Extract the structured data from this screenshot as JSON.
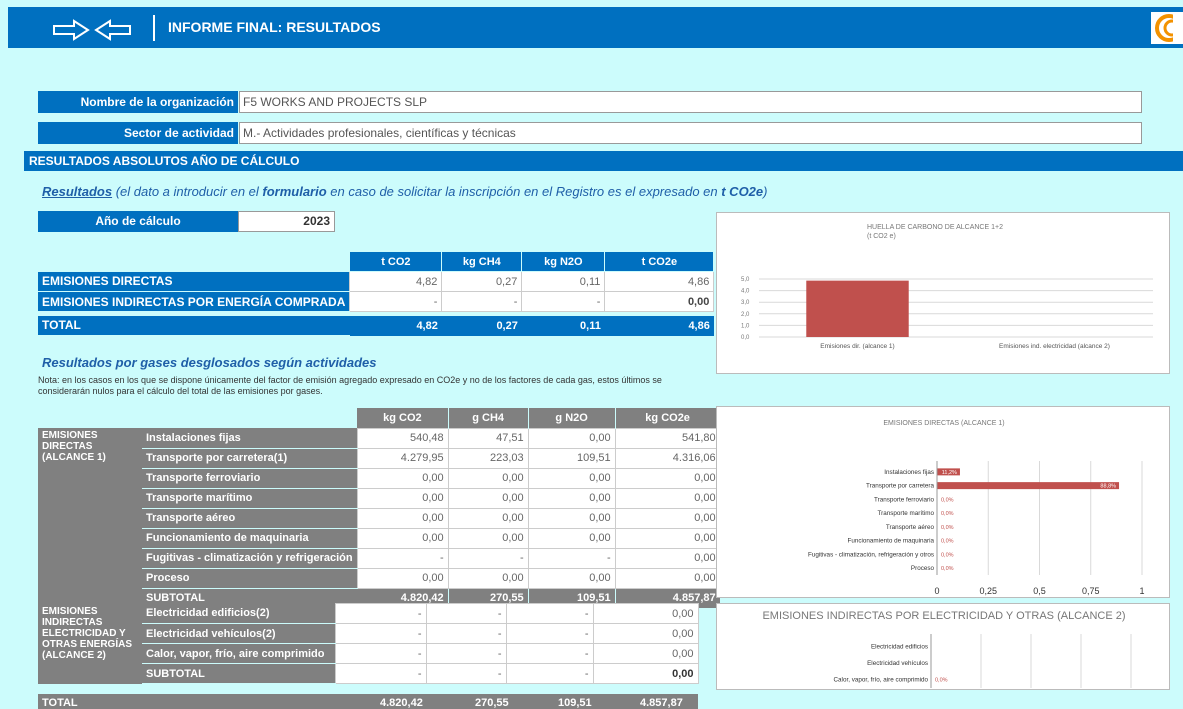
{
  "header": {
    "title": "INFORME FINAL: RESULTADOS"
  },
  "org": {
    "name_label": "Nombre de la organización",
    "name_value": "F5 WORKS AND PROJECTS SLP",
    "sector_label": "Sector de actividad",
    "sector_value": "M.- Actividades profesionales, científicas y técnicas"
  },
  "section_title": "RESULTADOS ABSOLUTOS AÑO DE CÁLCULO",
  "results_intro": {
    "word": "Resultados",
    "p1": " (el dato a introducir en el ",
    "bold": "formulario",
    "p2": " en caso de solicitar la inscripción en el Registro es el expresado en ",
    "unit": "t CO2e",
    "p3": ")"
  },
  "year": {
    "label": "Año  de cálculo",
    "value": "2023"
  },
  "summary_table": {
    "headers": [
      "t CO2",
      "kg CH4",
      "kg N2O",
      "t CO2e"
    ],
    "rows": [
      {
        "label": "EMISIONES DIRECTAS",
        "values": [
          "4,82",
          "0,27",
          "0,11",
          "4,86"
        ]
      },
      {
        "label": "EMISIONES INDIRECTAS POR ENERGÍA COMPRADA",
        "values": [
          "-",
          "-",
          "-",
          "0,00"
        ]
      }
    ],
    "total": {
      "label": "TOTAL",
      "values": [
        "4,82",
        "0,27",
        "0,11",
        "4,86"
      ]
    }
  },
  "gases": {
    "title": "Resultados por gases desglosados según actividades",
    "note": "Nota: en los casos en los que se dispone únicamente del factor de emisión agregado expresado en CO2e y no de los factores de cada gas, estos últimos se considerarán nulos para el cálculo del total de las emisiones por gases.",
    "headers": [
      "kg CO2",
      "g CH4",
      "g N2O",
      "kg CO2e"
    ],
    "group1": "EMISIONES DIRECTAS (ALCANCE 1)",
    "rows1": [
      {
        "label": "Instalaciones fijas",
        "values": [
          "540,48",
          "47,51",
          "0,00",
          "541,80"
        ]
      },
      {
        "label": "Transporte por carretera(1)",
        "values": [
          "4.279,95",
          "223,03",
          "109,51",
          "4.316,06"
        ]
      },
      {
        "label": "Transporte ferroviario",
        "values": [
          "0,00",
          "0,00",
          "0,00",
          "0,00"
        ]
      },
      {
        "label": "Transporte marítimo",
        "values": [
          "0,00",
          "0,00",
          "0,00",
          "0,00"
        ]
      },
      {
        "label": "Transporte aéreo",
        "values": [
          "0,00",
          "0,00",
          "0,00",
          "0,00"
        ]
      },
      {
        "label": "Funcionamiento de maquinaria",
        "values": [
          "0,00",
          "0,00",
          "0,00",
          "0,00"
        ]
      },
      {
        "label": "Fugitivas - climatización y refrigeración",
        "values": [
          "-",
          "-",
          "-",
          "0,00"
        ]
      },
      {
        "label": "Proceso",
        "values": [
          "0,00",
          "0,00",
          "0,00",
          "0,00"
        ]
      }
    ],
    "subtotal1": {
      "label": "SUBTOTAL",
      "values": [
        "4.820,42",
        "270,55",
        "109,51",
        "4.857,87"
      ]
    },
    "group2": "EMISIONES INDIRECTAS ELECTRICIDAD Y OTRAS ENERGÍAS (ALCANCE 2)",
    "rows2": [
      {
        "label": "Electricidad edificios(2)",
        "values": [
          "-",
          "-",
          "-",
          "0,00"
        ]
      },
      {
        "label": "Electricidad vehículos(2)",
        "values": [
          "-",
          "-",
          "-",
          "0,00"
        ]
      },
      {
        "label": "Calor, vapor, frío, aire comprimido",
        "values": [
          "-",
          "-",
          "-",
          "0,00"
        ]
      }
    ],
    "subtotal2": {
      "label": "SUBTOTAL",
      "values": [
        "-",
        "-",
        "-",
        "0,00"
      ]
    },
    "total": {
      "label": "TOTAL",
      "values": [
        "4.820,42",
        "270,55",
        "109,51",
        "4.857,87"
      ]
    }
  },
  "colors": {
    "blue": "#0070c0",
    "bg": "#ccfcfc",
    "gray": "#808080",
    "bar": "#c0504d"
  },
  "chart_data": [
    {
      "type": "bar",
      "title": "HUELLA DE CARBONO DE ALCANCE 1+2",
      "subtitle": "(t CO2 e)",
      "categories": [
        "Emisiones dir. (alcance 1)",
        "Emisiones ind. electricidad (alcance 2)"
      ],
      "values": [
        4.86,
        0
      ],
      "ylim": [
        0,
        5
      ],
      "yticks": [
        "0,0",
        "1,0",
        "2,0",
        "3,0",
        "4,0",
        "5,0"
      ],
      "grid": true
    },
    {
      "type": "bar",
      "orientation": "horizontal",
      "title": "EMISIONES DIRECTAS (ALCANCE 1)",
      "categories": [
        "Instalaciones fijas",
        "Transporte por carretera",
        "Transporte ferroviario",
        "Transporte marítimo",
        "Transporte aéreo",
        "Funcionamiento de maquinaria",
        "Fugitivas - climatización, refrigeración y otros",
        "Proceso"
      ],
      "values": [
        0.112,
        0.888,
        0,
        0,
        0,
        0,
        0,
        0
      ],
      "labels": [
        "11,2%",
        "88,8%",
        "0,0%",
        "0,0%",
        "0,0%",
        "0,0%",
        "0,0%",
        "0,0%"
      ],
      "xlim": [
        0,
        1
      ],
      "xticks": [
        "0",
        "0,25",
        "0,5",
        "0,75",
        "1"
      ]
    },
    {
      "type": "bar",
      "orientation": "horizontal",
      "title": "EMISIONES INDIRECTAS POR ELECTRICIDAD Y OTRAS (ALCANCE 2)",
      "categories": [
        "Electricidad edificios",
        "Electricidad vehículos",
        "Calor, vapor, frío, aire comprimido"
      ],
      "values": [
        0,
        0,
        0
      ],
      "labels": [
        "",
        "",
        "0,0%"
      ]
    }
  ]
}
